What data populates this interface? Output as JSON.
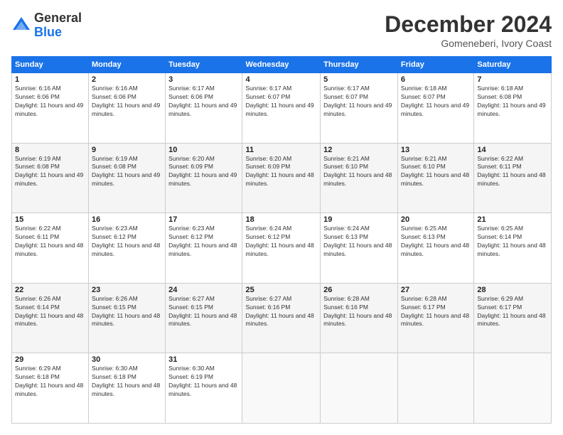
{
  "logo": {
    "general": "General",
    "blue": "Blue"
  },
  "header": {
    "month_title": "December 2024",
    "subtitle": "Gomeneberi, Ivory Coast"
  },
  "days_of_week": [
    "Sunday",
    "Monday",
    "Tuesday",
    "Wednesday",
    "Thursday",
    "Friday",
    "Saturday"
  ],
  "weeks": [
    [
      {
        "day": "1",
        "rise": "Sunrise: 6:16 AM",
        "set": "Sunset: 6:06 PM",
        "daylight": "Daylight: 11 hours and 49 minutes."
      },
      {
        "day": "2",
        "rise": "Sunrise: 6:16 AM",
        "set": "Sunset: 6:06 PM",
        "daylight": "Daylight: 11 hours and 49 minutes."
      },
      {
        "day": "3",
        "rise": "Sunrise: 6:17 AM",
        "set": "Sunset: 6:06 PM",
        "daylight": "Daylight: 11 hours and 49 minutes."
      },
      {
        "day": "4",
        "rise": "Sunrise: 6:17 AM",
        "set": "Sunset: 6:07 PM",
        "daylight": "Daylight: 11 hours and 49 minutes."
      },
      {
        "day": "5",
        "rise": "Sunrise: 6:17 AM",
        "set": "Sunset: 6:07 PM",
        "daylight": "Daylight: 11 hours and 49 minutes."
      },
      {
        "day": "6",
        "rise": "Sunrise: 6:18 AM",
        "set": "Sunset: 6:07 PM",
        "daylight": "Daylight: 11 hours and 49 minutes."
      },
      {
        "day": "7",
        "rise": "Sunrise: 6:18 AM",
        "set": "Sunset: 6:08 PM",
        "daylight": "Daylight: 11 hours and 49 minutes."
      }
    ],
    [
      {
        "day": "8",
        "rise": "Sunrise: 6:19 AM",
        "set": "Sunset: 6:08 PM",
        "daylight": "Daylight: 11 hours and 49 minutes."
      },
      {
        "day": "9",
        "rise": "Sunrise: 6:19 AM",
        "set": "Sunset: 6:08 PM",
        "daylight": "Daylight: 11 hours and 49 minutes."
      },
      {
        "day": "10",
        "rise": "Sunrise: 6:20 AM",
        "set": "Sunset: 6:09 PM",
        "daylight": "Daylight: 11 hours and 49 minutes."
      },
      {
        "day": "11",
        "rise": "Sunrise: 6:20 AM",
        "set": "Sunset: 6:09 PM",
        "daylight": "Daylight: 11 hours and 48 minutes."
      },
      {
        "day": "12",
        "rise": "Sunrise: 6:21 AM",
        "set": "Sunset: 6:10 PM",
        "daylight": "Daylight: 11 hours and 48 minutes."
      },
      {
        "day": "13",
        "rise": "Sunrise: 6:21 AM",
        "set": "Sunset: 6:10 PM",
        "daylight": "Daylight: 11 hours and 48 minutes."
      },
      {
        "day": "14",
        "rise": "Sunrise: 6:22 AM",
        "set": "Sunset: 6:11 PM",
        "daylight": "Daylight: 11 hours and 48 minutes."
      }
    ],
    [
      {
        "day": "15",
        "rise": "Sunrise: 6:22 AM",
        "set": "Sunset: 6:11 PM",
        "daylight": "Daylight: 11 hours and 48 minutes."
      },
      {
        "day": "16",
        "rise": "Sunrise: 6:23 AM",
        "set": "Sunset: 6:12 PM",
        "daylight": "Daylight: 11 hours and 48 minutes."
      },
      {
        "day": "17",
        "rise": "Sunrise: 6:23 AM",
        "set": "Sunset: 6:12 PM",
        "daylight": "Daylight: 11 hours and 48 minutes."
      },
      {
        "day": "18",
        "rise": "Sunrise: 6:24 AM",
        "set": "Sunset: 6:12 PM",
        "daylight": "Daylight: 11 hours and 48 minutes."
      },
      {
        "day": "19",
        "rise": "Sunrise: 6:24 AM",
        "set": "Sunset: 6:13 PM",
        "daylight": "Daylight: 11 hours and 48 minutes."
      },
      {
        "day": "20",
        "rise": "Sunrise: 6:25 AM",
        "set": "Sunset: 6:13 PM",
        "daylight": "Daylight: 11 hours and 48 minutes."
      },
      {
        "day": "21",
        "rise": "Sunrise: 6:25 AM",
        "set": "Sunset: 6:14 PM",
        "daylight": "Daylight: 11 hours and 48 minutes."
      }
    ],
    [
      {
        "day": "22",
        "rise": "Sunrise: 6:26 AM",
        "set": "Sunset: 6:14 PM",
        "daylight": "Daylight: 11 hours and 48 minutes."
      },
      {
        "day": "23",
        "rise": "Sunrise: 6:26 AM",
        "set": "Sunset: 6:15 PM",
        "daylight": "Daylight: 11 hours and 48 minutes."
      },
      {
        "day": "24",
        "rise": "Sunrise: 6:27 AM",
        "set": "Sunset: 6:15 PM",
        "daylight": "Daylight: 11 hours and 48 minutes."
      },
      {
        "day": "25",
        "rise": "Sunrise: 6:27 AM",
        "set": "Sunset: 6:16 PM",
        "daylight": "Daylight: 11 hours and 48 minutes."
      },
      {
        "day": "26",
        "rise": "Sunrise: 6:28 AM",
        "set": "Sunset: 6:16 PM",
        "daylight": "Daylight: 11 hours and 48 minutes."
      },
      {
        "day": "27",
        "rise": "Sunrise: 6:28 AM",
        "set": "Sunset: 6:17 PM",
        "daylight": "Daylight: 11 hours and 48 minutes."
      },
      {
        "day": "28",
        "rise": "Sunrise: 6:29 AM",
        "set": "Sunset: 6:17 PM",
        "daylight": "Daylight: 11 hours and 48 minutes."
      }
    ],
    [
      {
        "day": "29",
        "rise": "Sunrise: 6:29 AM",
        "set": "Sunset: 6:18 PM",
        "daylight": "Daylight: 11 hours and 48 minutes."
      },
      {
        "day": "30",
        "rise": "Sunrise: 6:30 AM",
        "set": "Sunset: 6:18 PM",
        "daylight": "Daylight: 11 hours and 48 minutes."
      },
      {
        "day": "31",
        "rise": "Sunrise: 6:30 AM",
        "set": "Sunset: 6:19 PM",
        "daylight": "Daylight: 11 hours and 48 minutes."
      },
      null,
      null,
      null,
      null
    ]
  ]
}
